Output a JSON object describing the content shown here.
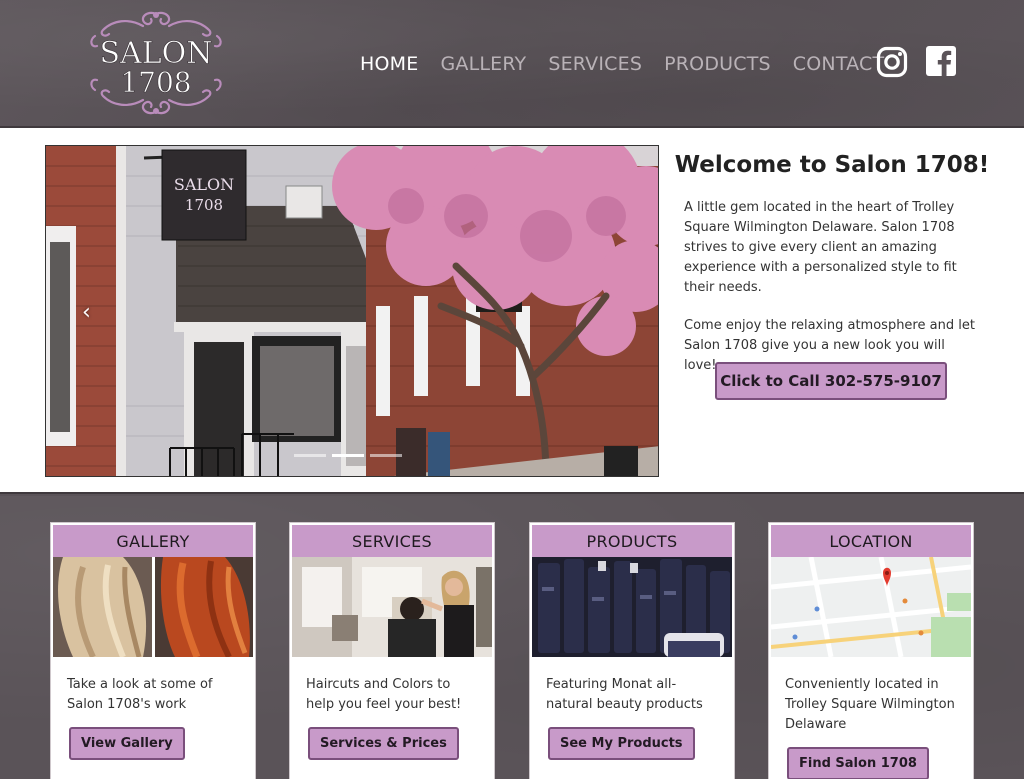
{
  "brand": {
    "logo_line1": "SALON",
    "logo_line2": "1708"
  },
  "nav": [
    {
      "label": "HOME",
      "active": true
    },
    {
      "label": "GALLERY",
      "active": false
    },
    {
      "label": "SERVICES",
      "active": false
    },
    {
      "label": "PRODUCTS",
      "active": false
    },
    {
      "label": "CONTACT",
      "active": false
    }
  ],
  "social": {
    "icons": [
      "instagram-icon",
      "facebook-icon"
    ]
  },
  "slider": {
    "sign_line1": "SALON",
    "sign_line2": "1708",
    "prev_arrow": "‹",
    "slide_count": 3,
    "active_slide": 1
  },
  "welcome": {
    "title": "Welcome to Salon 1708!",
    "paragraph1": "A little gem located in the heart of Trolley Square Wilmington Delaware. Salon 1708 strives to give every client an amazing experience with a personalized style to fit their needs.",
    "paragraph2": "Come enjoy the relaxing atmosphere and let Salon 1708 give you a new look you will love!",
    "call_button": "Click to Call 302-575-9107"
  },
  "cards": [
    {
      "title": "GALLERY",
      "text": "Take a look at some of Salon 1708's work",
      "button": "View Gallery"
    },
    {
      "title": "SERVICES",
      "text": "Haircuts and Colors to help you feel your best!",
      "button": "Services & Prices"
    },
    {
      "title": "PRODUCTS",
      "text": "Featuring Monat all-natural beauty products",
      "button": "See My Products"
    },
    {
      "title": "LOCATION",
      "text": "Conveniently located in Trolley Square Wilmington Delaware",
      "button": "Find Salon 1708"
    }
  ],
  "colors": {
    "header_bg": "#5a5358",
    "accent": "#c89ac9",
    "accent_border": "#7a4f7c",
    "nav_active": "#ffffff",
    "nav_inactive": "#b9b2b7"
  }
}
